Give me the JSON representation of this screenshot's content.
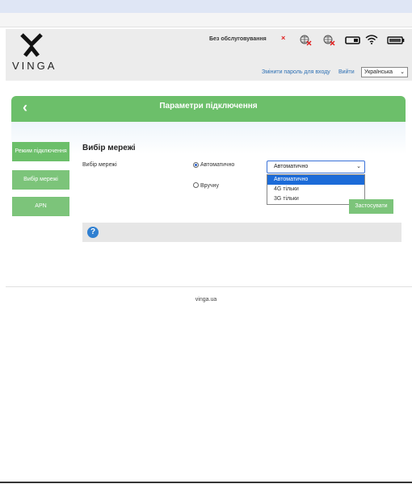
{
  "header": {
    "logo_text": "VINGA",
    "status_text": "Без обслуговування",
    "status_x": "×",
    "change_password_link": "Змінити пароль для входу",
    "exit_link": "Вийти",
    "language_selected": "Українська",
    "icons": [
      "no-signal-icon",
      "roaming-off-icon",
      "no-internet-icon",
      "sim-card-icon",
      "wifi-icon",
      "battery-icon"
    ]
  },
  "titlebar": {
    "title": "Параметри підключення",
    "back": "‹"
  },
  "sidebar": {
    "items": [
      {
        "label": "Режим підключення"
      },
      {
        "label": "Вибір мережі"
      },
      {
        "label": "APN"
      }
    ]
  },
  "main": {
    "section_title": "Вибір мережі",
    "field_label": "Вибір мережі",
    "radio_auto": "Автоматично",
    "radio_manual": "Вручну",
    "select_value": "Автоматично",
    "options": [
      "Автоматично",
      "4G тільки",
      "3G тільки"
    ],
    "apply_label": "Застосувати",
    "help": "?"
  },
  "footer": {
    "text": "vinga.ua"
  },
  "colors": {
    "accent": "#6cbf6a",
    "link": "#2d6fb3",
    "selected": "#1c6bd8"
  }
}
